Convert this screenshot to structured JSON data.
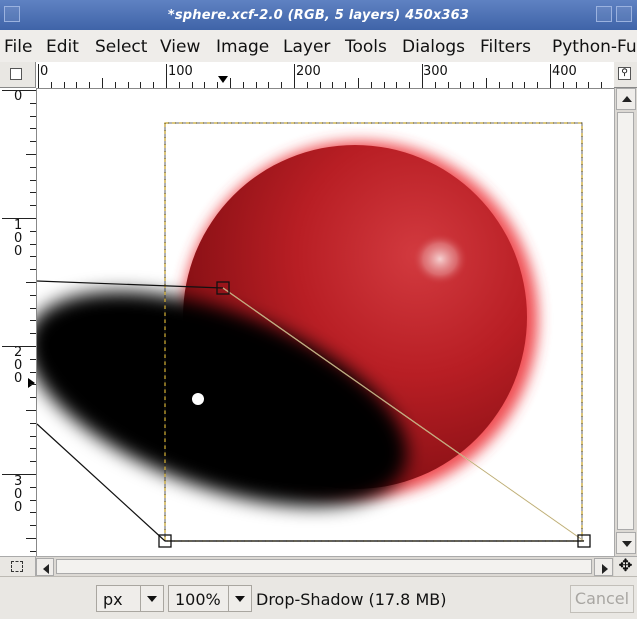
{
  "window": {
    "title": "*sphere.xcf-2.0 (RGB, 5 layers) 450x363"
  },
  "menubar": {
    "items": [
      {
        "label": "File"
      },
      {
        "label": "Edit"
      },
      {
        "label": "Select"
      },
      {
        "label": "View"
      },
      {
        "label": "Image"
      },
      {
        "label": "Layer"
      },
      {
        "label": "Tools"
      },
      {
        "label": "Dialogs"
      },
      {
        "label": "Filters"
      },
      {
        "label": "Python-Fu"
      }
    ]
  },
  "rulers": {
    "top_labels": [
      "0",
      "100",
      "200",
      "300",
      "400"
    ],
    "left_labels": [
      "0",
      "1\n0\n0",
      "2\n0\n0",
      "3\n0\n0"
    ]
  },
  "statusbar": {
    "unit": "px",
    "zoom": "100%",
    "message": "Drop-Shadow (17.8 MB)",
    "cancel_label": "Cancel"
  },
  "colors": {
    "titlebar": "#4a6fb3",
    "sphere": "#b81e24",
    "selection": "#c8a632"
  },
  "icons": {
    "ruler_toggle": "ruler-toggle-icon",
    "zoom": "zoom-icon",
    "quick_mask": "quick-mask-icon",
    "navigate": "navigate-icon"
  }
}
